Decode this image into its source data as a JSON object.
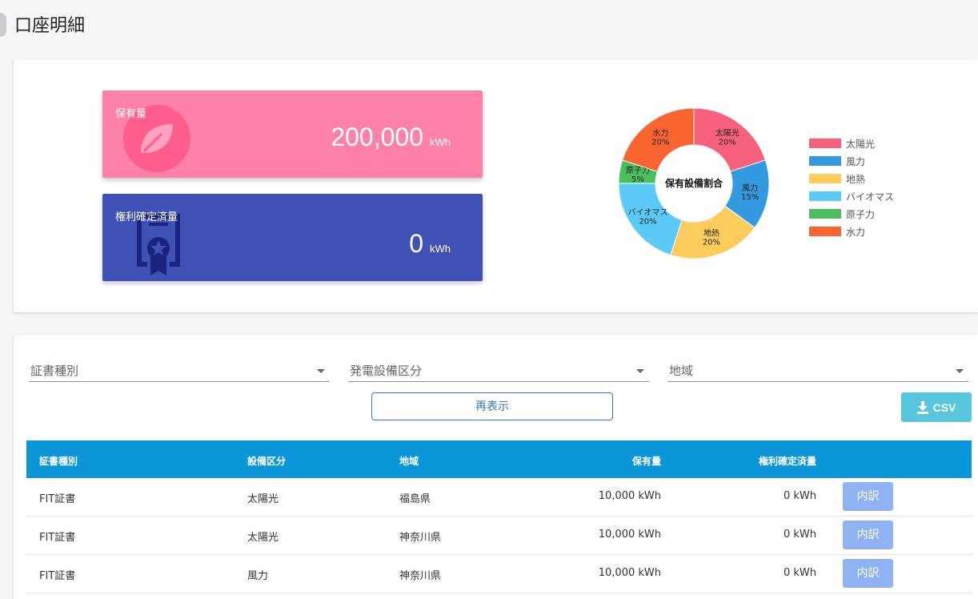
{
  "page": {
    "title": "口座明細"
  },
  "summary": {
    "holding": {
      "label": "保有量",
      "value": "200,000",
      "unit": "kWh",
      "color": "#fe82a8"
    },
    "confirmed": {
      "label": "権利確定済量",
      "value": "0",
      "unit": "kWh",
      "color": "#3f51b5"
    }
  },
  "chart_data": {
    "type": "pie",
    "title": "保有設備割合",
    "donut": true,
    "legend_position": "right",
    "categories": [
      "太陽光",
      "風力",
      "地熱",
      "バイオマス",
      "原子力",
      "水力"
    ],
    "values": [
      20,
      15,
      20,
      20,
      5,
      20
    ],
    "percent_labels": [
      "20%",
      "15%",
      "20%",
      "20%",
      "5%",
      "20%"
    ],
    "colors": [
      "#f7617c",
      "#3399e0",
      "#fecb5d",
      "#5ccaf8",
      "#4bbf5d",
      "#fa6431"
    ]
  },
  "filters": {
    "cert_type": {
      "placeholder": "証書種別"
    },
    "facility_type": {
      "placeholder": "発電設備区分"
    },
    "region": {
      "placeholder": "地域"
    }
  },
  "actions": {
    "redisplay_label": "再表示",
    "csv_label": "CSV"
  },
  "table": {
    "headers": [
      "証書種別",
      "設備区分",
      "地域",
      "保有量",
      "権利確定済量"
    ],
    "rows": [
      {
        "cert": "FIT証書",
        "facility": "太陽光",
        "region": "福島県",
        "holding": "10,000 kWh",
        "confirmed": "0 kWh",
        "button": "内訳"
      },
      {
        "cert": "FIT証書",
        "facility": "太陽光",
        "region": "神奈川県",
        "holding": "10,000 kWh",
        "confirmed": "0 kWh",
        "button": "内訳"
      },
      {
        "cert": "FIT証書",
        "facility": "風力",
        "region": "神奈川県",
        "holding": "10,000 kWh",
        "confirmed": "0 kWh",
        "button": "内訳"
      }
    ]
  }
}
